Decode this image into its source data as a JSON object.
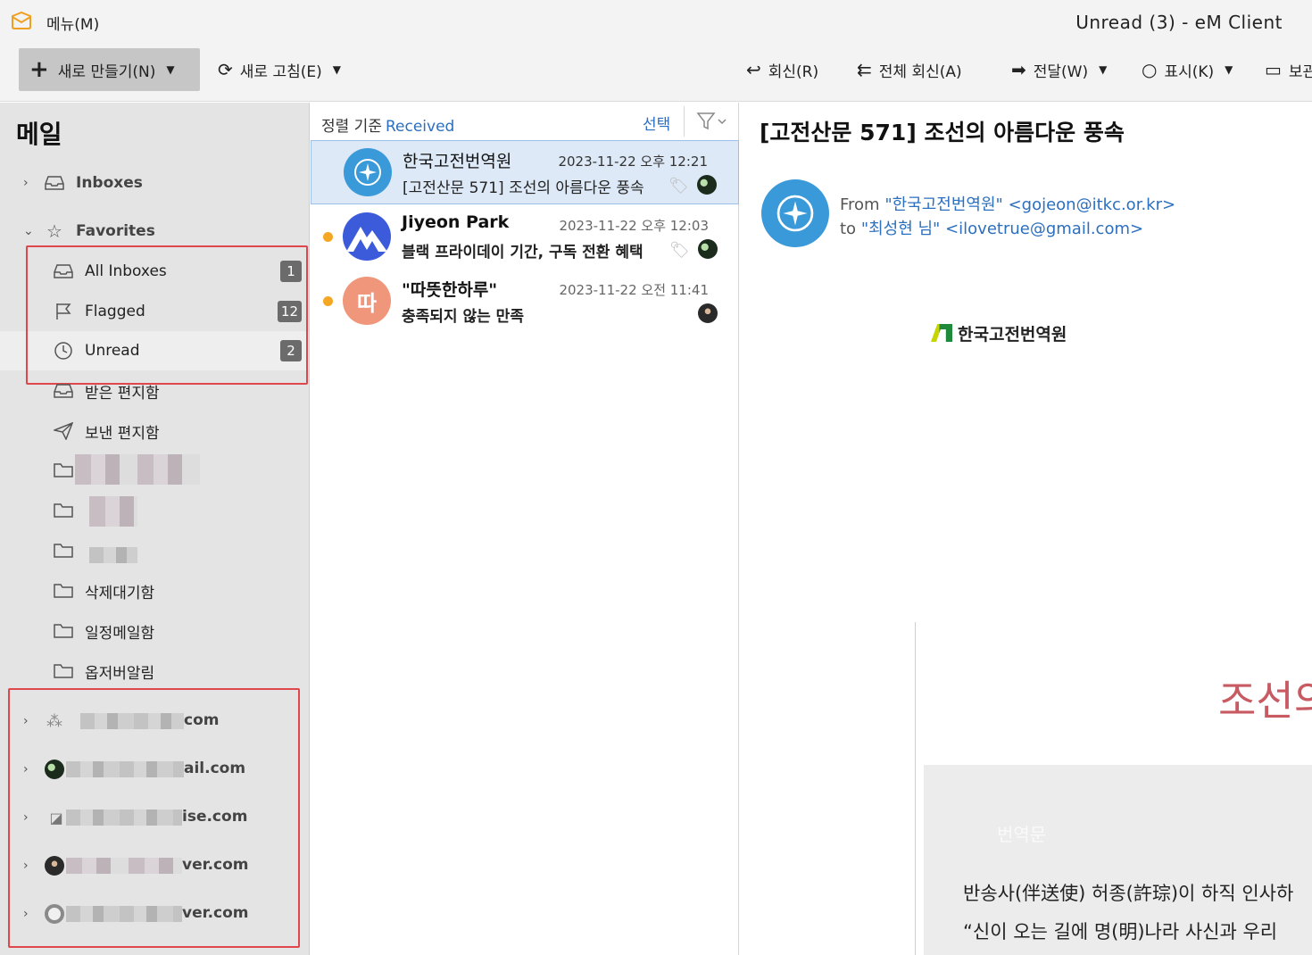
{
  "titlebar": {
    "menu_label": "메뉴(M)",
    "window_title": "Unread (3) - eM Client"
  },
  "toolbar": {
    "new_label": "새로 만들기(N)",
    "refresh_label": "새로 고침(E)",
    "reply_label": "회신(R)",
    "reply_all_label": "전체 회신(A)",
    "forward_label": "전달(W)",
    "mark_label": "표시(K)",
    "archive_label": "보관"
  },
  "sidebar": {
    "title": "메일",
    "groups": {
      "inboxes": "Inboxes",
      "favorites": "Favorites"
    },
    "favorites": [
      {
        "label": "All Inboxes",
        "count": "1"
      },
      {
        "label": "Flagged",
        "count": "12"
      },
      {
        "label": "Unread",
        "count": "2"
      }
    ],
    "folders": [
      "받은 편지함",
      "보낸 편지함",
      "삭제대기함",
      "일정메일함",
      "옵저버알림"
    ],
    "accounts": [
      "com",
      "ail.com",
      "ise.com",
      "ver.com",
      "ver.com"
    ]
  },
  "list": {
    "sort_prefix": "정렬 기준",
    "sort_value": "Received",
    "select_label": "선택",
    "messages": [
      {
        "sender": "한국고전번역원",
        "date": "2023-11-22 오후 12:21",
        "subject": "[고전산문 571] 조선의 아름다운 풍속"
      },
      {
        "sender": "Jiyeon Park",
        "date": "2023-11-22 오후 12:03",
        "subject": "블랙 프라이데이 기간, 구독 전환 혜택"
      },
      {
        "sender": "\"따뜻한하루\"",
        "date": "2023-11-22 오전 11:41",
        "subject": "충족되지 않는 만족",
        "avatar_text": "따"
      }
    ]
  },
  "reader": {
    "subject": "[고전산문 571] 조선의 아름다운 풍속",
    "from_prefix": "From",
    "from_name": "\"한국고전번역원\"",
    "from_email": "<gojeon@itkc.or.kr>",
    "to_prefix": "to",
    "to_name": "\"최성현 님\"",
    "to_email": "<ilovetrue@gmail.com>",
    "org_logo_text": "한국고전번역원",
    "big_title": "조선의",
    "section_label": "번역문",
    "body_line1": "반송사(伴送使) 허종(許琮)이 하직 인사하",
    "body_line2": "“신이 오는 길에 명(明)나라 사신과 우리"
  },
  "colors": {
    "accent_blue": "#2c6fbf",
    "badge_gray": "#6b6b6b",
    "highlight_red": "#e0474c",
    "unread_dot": "#f5a623",
    "title_red": "#c85a62"
  }
}
